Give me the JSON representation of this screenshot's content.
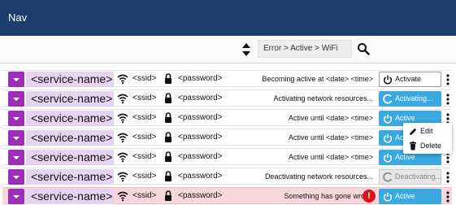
{
  "nav": {
    "title": "Nav"
  },
  "toolbar": {
    "filter_text": "Error > Active > WiFi"
  },
  "rows": [
    {
      "name": "<service-name>",
      "ssid": "<ssid>",
      "password": "<password>",
      "status": "Becoming active at <date> <time>",
      "action": "Activate",
      "action_style": "outline"
    },
    {
      "name": "<service-name>",
      "ssid": "<ssid>",
      "password": "<password>",
      "status": "Activating network resources...",
      "action": "Activating...",
      "action_style": "blue-loading"
    },
    {
      "name": "<service-name>",
      "ssid": "<ssid>",
      "password": "<password>",
      "status": "Active until <date> <time>",
      "action": "Active",
      "action_style": "blue"
    },
    {
      "name": "<service-name>",
      "ssid": "<ssid>",
      "password": "<password>",
      "status": "Active until <date> <time>",
      "action": "Active",
      "action_style": "blue"
    },
    {
      "name": "<service-name>",
      "ssid": "<ssid>",
      "password": "<password>",
      "status": "Active until <date> <time>",
      "action": "Active",
      "action_style": "blue"
    },
    {
      "name": "<service-name>",
      "ssid": "<ssid>",
      "password": "<password>",
      "status": "Deactivating network resources...",
      "action": "Deactivating...",
      "action_style": "gray-loading"
    },
    {
      "name": "<service-name>",
      "ssid": "<ssid>",
      "password": "<password>",
      "status": "Something has gone wrong",
      "action": "Active",
      "action_style": "blue",
      "error": true
    }
  ],
  "context_menu": {
    "edit_label": "Edit",
    "delete_label": "Delete"
  },
  "colors": {
    "navbar": "#1a3d6d",
    "accent_purple": "#9b2fb9",
    "name_bg": "#e6d3f0",
    "active_blue": "#3aa9e0",
    "error_bg": "#f8d7dc",
    "error_red": "#d7151b"
  },
  "icons": {
    "sort": "sort-icon",
    "search": "search-icon",
    "wifi": "wifi-icon",
    "lock": "lock-icon",
    "power": "power-icon",
    "spinner": "spinner-icon",
    "kebab": "kebab-icon",
    "error": "error-icon",
    "edit": "pencil-icon",
    "delete": "trash-icon"
  }
}
